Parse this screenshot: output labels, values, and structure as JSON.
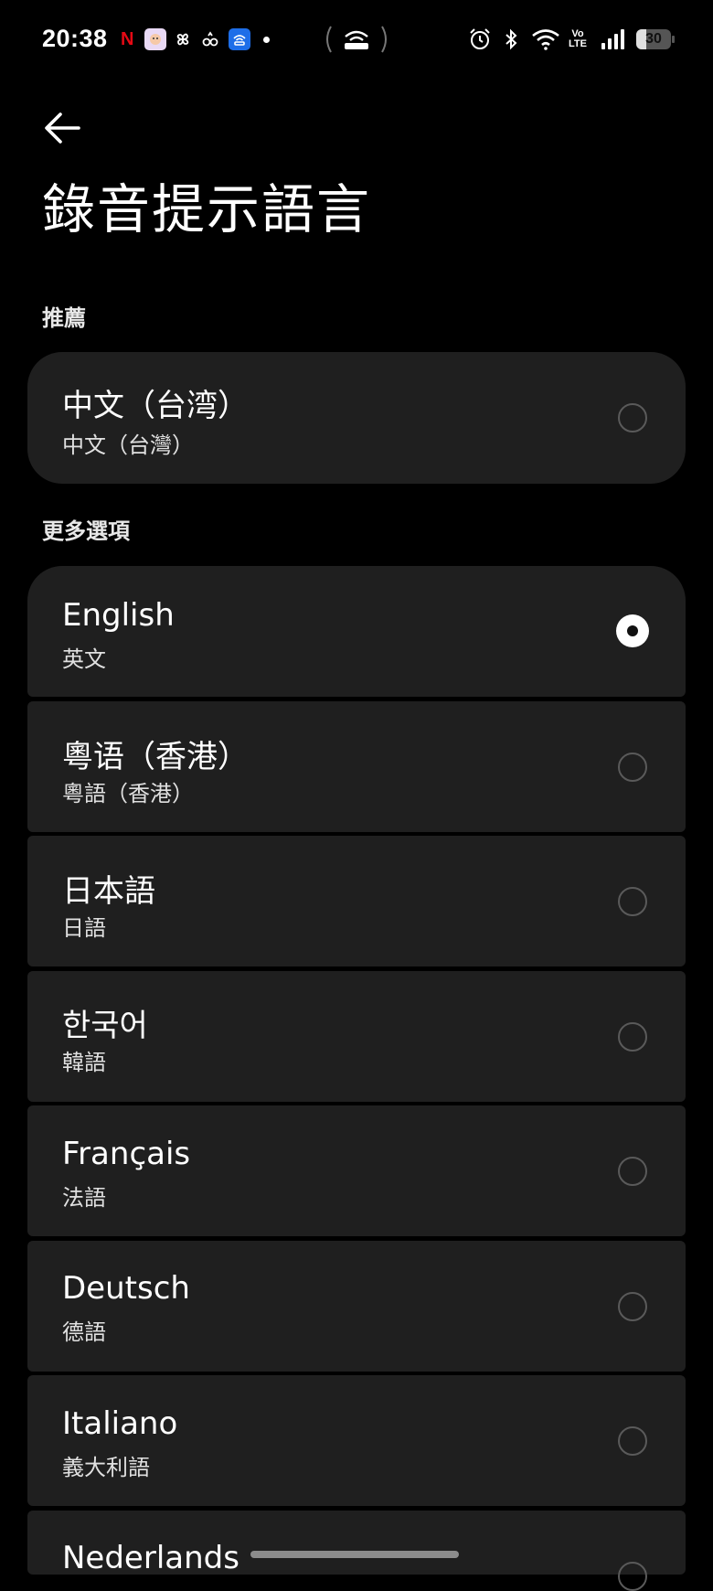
{
  "status_bar": {
    "time": "20:38",
    "netflix_letter": "N",
    "battery": "30",
    "network_badge_top": "Vo",
    "network_badge_bottom": "LTE"
  },
  "header": {
    "back_icon": "arrow-left-icon",
    "title": "錄音提示語言"
  },
  "sections": {
    "recommended": "推薦",
    "more": "更多選項"
  },
  "recommended_items": [
    {
      "primary": "中文（台湾）",
      "secondary": "中文（台灣）",
      "selected": false
    }
  ],
  "more_items": [
    {
      "primary": "English",
      "secondary": "英文",
      "selected": true
    },
    {
      "primary": "粵语（香港）",
      "secondary": "粵語（香港）",
      "selected": false
    },
    {
      "primary": "日本語",
      "secondary": "日語",
      "selected": false
    },
    {
      "primary": "한국어",
      "secondary": "韓語",
      "selected": false
    },
    {
      "primary": "Français",
      "secondary": "法語",
      "selected": false
    },
    {
      "primary": "Deutsch",
      "secondary": "德語",
      "selected": false
    },
    {
      "primary": "Italiano",
      "secondary": "義大利語",
      "selected": false
    },
    {
      "primary": "Nederlands",
      "secondary": "",
      "selected": false
    }
  ],
  "colors": {
    "background": "#000000",
    "card": "#1f1f1f",
    "radio_selected": "#ffffff",
    "radio_border": "#5a5a5a",
    "netflix": "#e50914"
  }
}
